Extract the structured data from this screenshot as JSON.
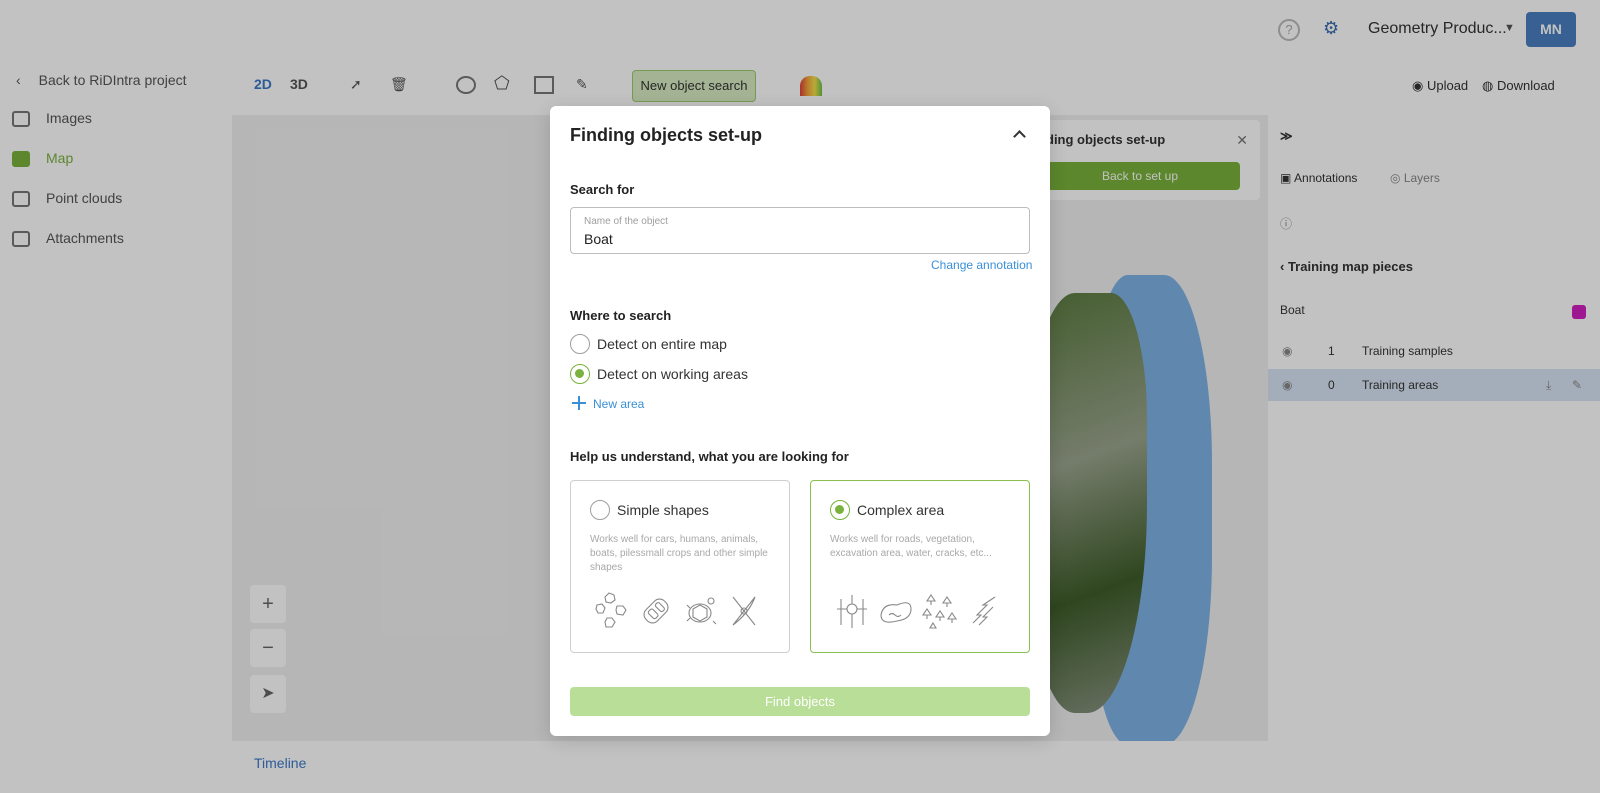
{
  "topbar": {
    "project_name": "Geometry Produc...",
    "avatar_initials": "MN"
  },
  "sidebar": {
    "back_label": "Back to RiDIntra project",
    "items": [
      {
        "label": "Images"
      },
      {
        "label": "Map"
      },
      {
        "label": "Point clouds"
      },
      {
        "label": "Attachments"
      }
    ]
  },
  "toolbar": {
    "view_2d": "2D",
    "view_3d": "3D",
    "new_object_search": "New object search",
    "upload_label": "Upload",
    "download_label": "Download"
  },
  "overlay_panel": {
    "title": "ding objects set-up",
    "back_button": "Back to set up"
  },
  "right_panel": {
    "tab_annotations": "Annotations",
    "tab_layers": "Layers",
    "section_title": "Training map pieces",
    "class_name": "Boat",
    "rows": [
      {
        "index": "1",
        "label": "Training samples"
      },
      {
        "index": "0",
        "label": "Training areas"
      }
    ]
  },
  "timeline": {
    "label": "Timeline"
  },
  "modal": {
    "title": "Finding objects set-up",
    "search_for_label": "Search for",
    "object_field": {
      "placeholder": "Name of the object",
      "value": "Boat"
    },
    "change_annotation_link": "Change annotation",
    "where_to_search_label": "Where to search",
    "search_options": [
      {
        "label": "Detect on entire map",
        "selected": false
      },
      {
        "label": "Detect on working areas",
        "selected": true
      }
    ],
    "new_area_link": "New area",
    "help_label": "Help us understand, what you are looking for",
    "cards": [
      {
        "title": "Simple shapes",
        "description": "Works well for cars, humans, animals, boats, pilessmall crops and other simple shapes",
        "selected": false,
        "icons": [
          "rocks-icon",
          "car-icon",
          "turtle-icon",
          "kayak-icon"
        ]
      },
      {
        "title": "Complex area",
        "description": "Works well for roads, vegetation, excavation area, water, cracks, etc...",
        "selected": true,
        "icons": [
          "roads-icon",
          "water-icon",
          "trees-icon",
          "cracks-icon"
        ]
      }
    ],
    "find_button": "Find objects"
  },
  "colors": {
    "accent_green": "#79b23c",
    "link_blue": "#3a8fd6",
    "disabled_green": "#b9de98"
  }
}
